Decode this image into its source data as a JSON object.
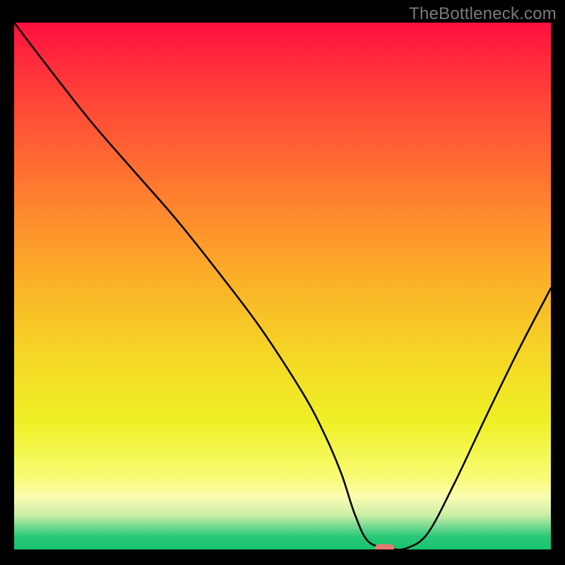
{
  "watermark": "TheBottleneck.com",
  "chart_data": {
    "type": "line",
    "title": "",
    "xlabel": "",
    "ylabel": "",
    "xlim": [
      0,
      100
    ],
    "ylim": [
      0,
      100
    ],
    "grid": false,
    "legend": false,
    "background": {
      "type": "vertical-gradient",
      "stops": [
        {
          "pos": 0.0,
          "color": "#ff103f"
        },
        {
          "pos": 0.14,
          "color": "#ff4238"
        },
        {
          "pos": 0.32,
          "color": "#ff7c2f"
        },
        {
          "pos": 0.48,
          "color": "#fbae28"
        },
        {
          "pos": 0.63,
          "color": "#f5d625"
        },
        {
          "pos": 0.76,
          "color": "#eef126"
        },
        {
          "pos": 0.86,
          "color": "#f8fb71"
        },
        {
          "pos": 0.9,
          "color": "#fbfcb0"
        },
        {
          "pos": 0.935,
          "color": "#c9eea6"
        },
        {
          "pos": 0.958,
          "color": "#6fd88f"
        },
        {
          "pos": 0.975,
          "color": "#2ac977"
        },
        {
          "pos": 1.0,
          "color": "#18c36d"
        }
      ]
    },
    "series": [
      {
        "name": "bottleneck-curve",
        "color": "#000000",
        "type": "line",
        "x": [
          0,
          5,
          14,
          22,
          30,
          38,
          46,
          54,
          58,
          61,
          63.5,
          66,
          70,
          73,
          77,
          82,
          88,
          94,
          100
        ],
        "y": [
          100,
          93.3,
          81.6,
          72.2,
          62.9,
          52.7,
          41.9,
          29.3,
          21.5,
          14.3,
          6.6,
          1.5,
          0.2,
          0.2,
          3.0,
          12.5,
          25.4,
          37.9,
          49.6
        ]
      }
    ],
    "marker": {
      "name": "target-marker",
      "shape": "rounded-rect",
      "fill": "#e9786d",
      "cx": 69,
      "cy": 0,
      "w": 3.6,
      "h": 2.0
    }
  }
}
